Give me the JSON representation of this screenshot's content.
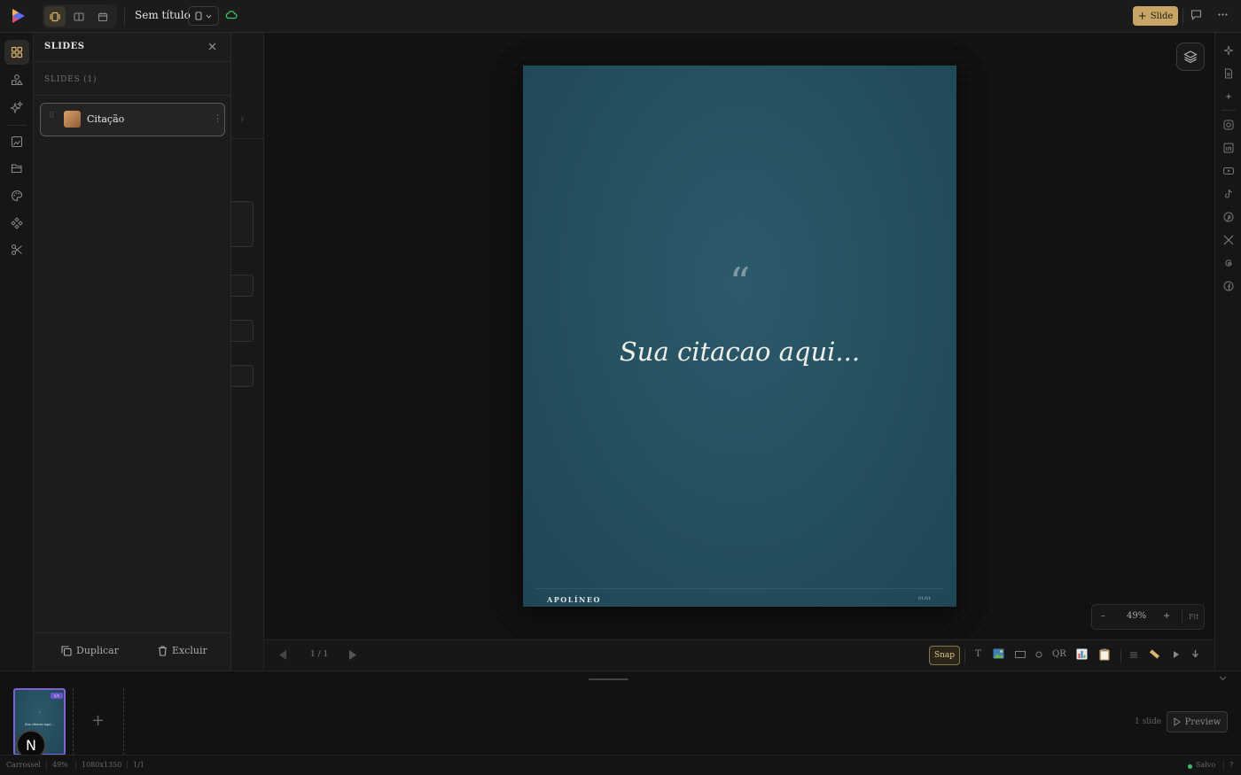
{
  "header": {
    "title": "Sem título",
    "add_slide_label": "Slide",
    "add_slide_icon": "plus-icon"
  },
  "panel": {
    "title": "SLIDES",
    "subtitle": "SLIDES (1)",
    "items": [
      {
        "label": "Citação",
        "icon": "scroll-icon",
        "menu": "⋮"
      }
    ],
    "duplicate_label": "Duplicar",
    "delete_label": "Excluir"
  },
  "slide": {
    "quote_mark": "“",
    "quote_text": "Sua citacao aqui...",
    "brand": "APOLÍNEO",
    "page": "01/01",
    "background": "#244f5f"
  },
  "canvas": {
    "zoom_minus": "–",
    "zoom_value": "49%",
    "zoom_plus": "+",
    "zoom_fit": "Fit",
    "pager": "1 / 1"
  },
  "toolbar": {
    "snap_label": "Snap",
    "text_tool": "T",
    "qr_tool": "QR"
  },
  "filmstrip": {
    "add_label": "+",
    "avatar_letter": "N",
    "count_label": "1 slide",
    "preview_label": "Preview",
    "thumb_badge": "1/1",
    "thumb_text": "Sua citacao aqui..."
  },
  "status": {
    "mode": "Carrossel",
    "zoom": "49%",
    "size": "1080x1350",
    "pages": "1/1",
    "saved": "Salvo",
    "help": "?"
  },
  "colors": {
    "accent": "#c9a565",
    "selection": "#7d63d6",
    "saved": "#3fbf6a"
  }
}
